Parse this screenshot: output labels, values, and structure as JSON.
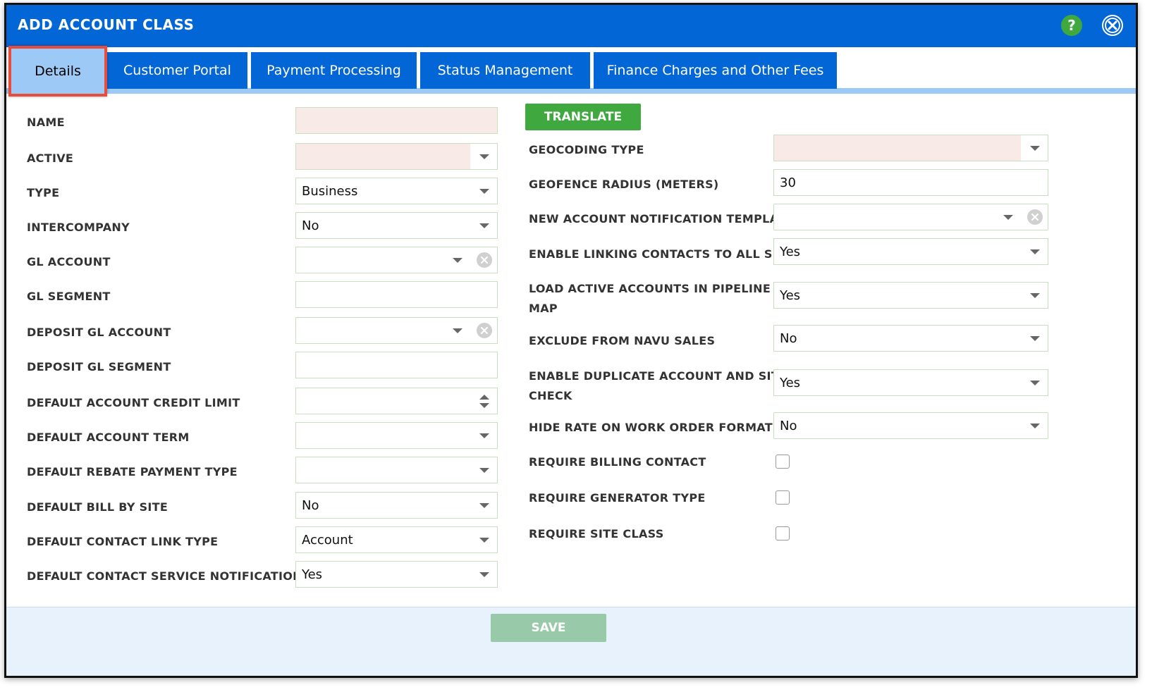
{
  "dialog": {
    "title": "ADD ACCOUNT CLASS"
  },
  "tabs": [
    {
      "label": "Details",
      "active": true
    },
    {
      "label": "Customer Portal"
    },
    {
      "label": "Payment Processing"
    },
    {
      "label": "Status Management"
    },
    {
      "label": "Finance Charges and Other Fees"
    }
  ],
  "left": {
    "name_label": "NAME",
    "active_label": "ACTIVE",
    "type_label": "TYPE",
    "type_value": "Business",
    "intercompany_label": "INTERCOMPANY",
    "intercompany_value": "No",
    "gl_account_label": "GL ACCOUNT",
    "gl_segment_label": "GL SEGMENT",
    "deposit_gl_account_label": "DEPOSIT GL ACCOUNT",
    "deposit_gl_segment_label": "DEPOSIT GL SEGMENT",
    "credit_limit_label": "DEFAULT ACCOUNT CREDIT LIMIT",
    "account_term_label": "DEFAULT ACCOUNT TERM",
    "rebate_payment_label": "DEFAULT REBATE PAYMENT TYPE",
    "bill_by_site_label": "DEFAULT BILL BY SITE",
    "bill_by_site_value": "No",
    "contact_link_label": "DEFAULT CONTACT LINK TYPE",
    "contact_link_value": "Account",
    "contact_service_label": "DEFAULT CONTACT SERVICE NOTIFICATION",
    "contact_service_value": "Yes"
  },
  "right": {
    "translate_label": "TRANSLATE",
    "geocoding_label": "GEOCODING TYPE",
    "geofence_label": "GEOFENCE RADIUS (METERS)",
    "geofence_value": "30",
    "notification_template_label": "NEW ACCOUNT NOTIFICATION TEMPLATE",
    "linking_contacts_label": "ENABLE LINKING CONTACTS TO ALL SITES",
    "linking_contacts_value": "Yes",
    "pipeline_label_line1": "LOAD ACTIVE ACCOUNTS IN PIPELINE",
    "pipeline_label_line2": "MAP",
    "pipeline_value": "Yes",
    "exclude_navu_label": "EXCLUDE FROM NAVU SALES",
    "exclude_navu_value": "No",
    "duplicate_check_label_line1": "ENABLE DUPLICATE ACCOUNT AND SITE",
    "duplicate_check_label_line2": "CHECK",
    "duplicate_check_value": "Yes",
    "hide_rate_label": "HIDE RATE ON WORK ORDER FORMAT",
    "hide_rate_value": "No",
    "require_billing_label": "REQUIRE BILLING CONTACT",
    "require_generator_label": "REQUIRE GENERATOR TYPE",
    "require_site_class_label": "REQUIRE SITE CLASS"
  },
  "footer": {
    "save_label": "SAVE"
  },
  "colors": {
    "primary": "#0366d6",
    "tab_active": "#9cc9f5",
    "green": "#3fa83f",
    "required_bg": "#f8ebe7",
    "highlight": "#e74c3c"
  }
}
